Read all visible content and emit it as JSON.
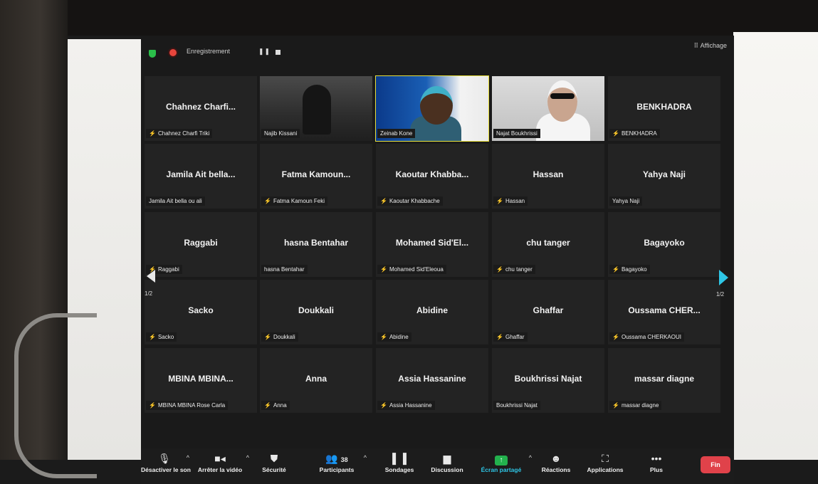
{
  "topbar": {
    "recording_label": "Enregistrement",
    "pause_glyph": "❚❚",
    "view_label": "Affichage",
    "view_icon": "grid-icon"
  },
  "pagination": {
    "left": "1/2",
    "right": "1/2"
  },
  "tiles": [
    {
      "display": "Chahnez Charfi...",
      "name": "Chahnez Charfi Triki",
      "muted": true
    },
    {
      "display": "",
      "name": "Najib Kissani",
      "muted": false,
      "video": "scene1"
    },
    {
      "display": "",
      "name": "Zeinab Kone",
      "muted": false,
      "video": "scene2",
      "active": true
    },
    {
      "display": "",
      "name": "Najat Boukhrissi",
      "muted": false,
      "video": "scene3"
    },
    {
      "display": "BENKHADRA",
      "name": "BENKHADRA",
      "muted": true
    },
    {
      "display": "Jamila Ait bella...",
      "name": "Jamila Ait bella ou ali",
      "muted": false
    },
    {
      "display": "Fatma Kamoun...",
      "name": "Fatma Kamoun Feki",
      "muted": true
    },
    {
      "display": "Kaoutar Khabba...",
      "name": "Kaoutar Khabbache",
      "muted": true
    },
    {
      "display": "Hassan",
      "name": "Hassan",
      "muted": true
    },
    {
      "display": "Yahya Naji",
      "name": "Yahya Naji",
      "muted": false
    },
    {
      "display": "Raggabi",
      "name": "Raggabi",
      "muted": true
    },
    {
      "display": "hasna Bentahar",
      "name": "hasna Bentahar",
      "muted": false
    },
    {
      "display": "Mohamed Sid'El...",
      "name": "Mohamed Sid'Eleoua",
      "muted": true
    },
    {
      "display": "chu tanger",
      "name": "chu tanger",
      "muted": true
    },
    {
      "display": "Bagayoko",
      "name": "Bagayoko",
      "muted": true
    },
    {
      "display": "Sacko",
      "name": "Sacko",
      "muted": true
    },
    {
      "display": "Doukkali",
      "name": "Doukkali",
      "muted": true
    },
    {
      "display": "Abidine",
      "name": "Abidine",
      "muted": true
    },
    {
      "display": "Ghaffar",
      "name": "Ghaffar",
      "muted": true
    },
    {
      "display": "Oussama CHER...",
      "name": "Oussama CHERKAOUI",
      "muted": true
    },
    {
      "display": "MBINA MBINA...",
      "name": "MBINA MBINA Rose Carla",
      "muted": true
    },
    {
      "display": "Anna",
      "name": "Anna",
      "muted": true
    },
    {
      "display": "Assia Hassanine",
      "name": "Assia Hassanine",
      "muted": true
    },
    {
      "display": "Boukhrissi Najat",
      "name": "Boukhrissi Najat",
      "muted": false
    },
    {
      "display": "massar diagne",
      "name": "massar diagne",
      "muted": true
    }
  ],
  "toolbar": {
    "mute": {
      "label": "Désactiver le son",
      "icon": "microphone-icon"
    },
    "video": {
      "label": "Arrêter la vidéo",
      "icon": "camera-icon"
    },
    "security": {
      "label": "Sécurité",
      "icon": "shield-icon"
    },
    "participants": {
      "label": "Participants",
      "count": "38",
      "icon": "people-icon"
    },
    "polls": {
      "label": "Sondages",
      "icon": "bar-chart-icon"
    },
    "chat": {
      "label": "Discussion",
      "icon": "chat-bubble-icon"
    },
    "share": {
      "label": "Écran partagé",
      "icon": "share-screen-icon"
    },
    "reactions": {
      "label": "Réactions",
      "icon": "smiley-icon"
    },
    "apps": {
      "label": "Applications",
      "icon": "apps-icon"
    },
    "more": {
      "label": "Plus",
      "icon": "more-dots-icon"
    },
    "end": {
      "label": "Fin"
    }
  },
  "colors": {
    "active_speaker": "#e8df3a",
    "muted_mic": "#e0403a",
    "share_green": "#23b14d",
    "accent_blue": "#2ec6e6",
    "end_red": "#e0424a"
  }
}
